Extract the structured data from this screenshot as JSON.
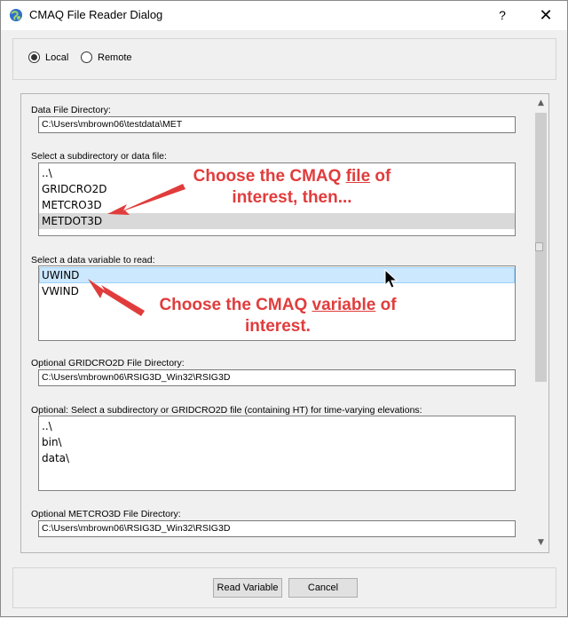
{
  "window": {
    "title": "CMAQ File Reader Dialog",
    "help_label": "?",
    "close_label": "✕"
  },
  "mode": {
    "options": [
      {
        "label": "Local",
        "checked": true
      },
      {
        "label": "Remote",
        "checked": false
      }
    ]
  },
  "data_file_directory": {
    "label": "Data File Directory:",
    "value": "C:\\Users\\mbrown06\\testdata\\MET"
  },
  "subdirectory_list": {
    "label": "Select a subdirectory or data file:",
    "items": [
      "..\\",
      "GRIDCRO2D",
      "METCRO3D",
      "METDOT3D"
    ],
    "selected": "METDOT3D"
  },
  "variable_list": {
    "label": "Select a data variable to read:",
    "items": [
      "UWIND",
      "VWIND"
    ],
    "selected": "UWIND"
  },
  "gridcro2d_directory": {
    "label": "Optional GRIDCRO2D File Directory:",
    "value": "C:\\Users\\mbrown06\\RSIG3D_Win32\\RSIG3D"
  },
  "gridcro2d_list": {
    "label": "Optional: Select a subdirectory or GRIDCRO2D file (containing HT) for time-varying elevations:",
    "items": [
      "..\\",
      "bin\\",
      "data\\"
    ]
  },
  "metcro3d_directory": {
    "label": "Optional METCRO3D File Directory:",
    "value": "C:\\Users\\mbrown06\\RSIG3D_Win32\\RSIG3D"
  },
  "annotations": {
    "file_pre": "Choose the CMAQ ",
    "file_word": "file",
    "file_post": " of",
    "file_line2": "interest, then...",
    "var_pre": "Choose the CMAQ ",
    "var_word": "variable",
    "var_post": " of",
    "var_line2": "interest."
  },
  "buttons": {
    "read_variable": "Read Variable",
    "cancel": "Cancel"
  },
  "colors": {
    "annotation": "#e13c3c",
    "selection_blue": "#cce8ff",
    "selection_grey": "#d9d9d9"
  }
}
